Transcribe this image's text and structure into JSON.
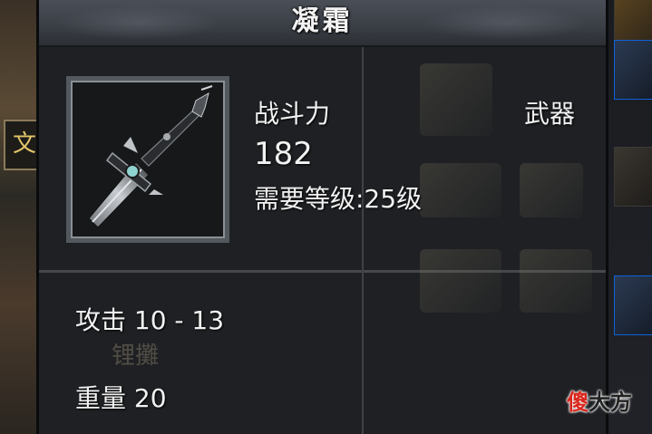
{
  "item": {
    "name": "凝霜",
    "combat_power_label": "战斗力",
    "combat_power": "182",
    "required_level": "需要等级:25级",
    "category": "武器",
    "attack": "攻击 10 - 13",
    "weight": "重量 20"
  },
  "background": {
    "hud_glyph": "文",
    "faded_label": "锂攤"
  },
  "watermark": {
    "first": "傻",
    "rest": "大方"
  },
  "icons": {
    "item_icon": "sword-icon"
  },
  "colors": {
    "text": "#f2f2f2",
    "panel_bg": "#1e2023",
    "title_bar": "#3a3e45",
    "watermark_red": "#d9261c"
  }
}
